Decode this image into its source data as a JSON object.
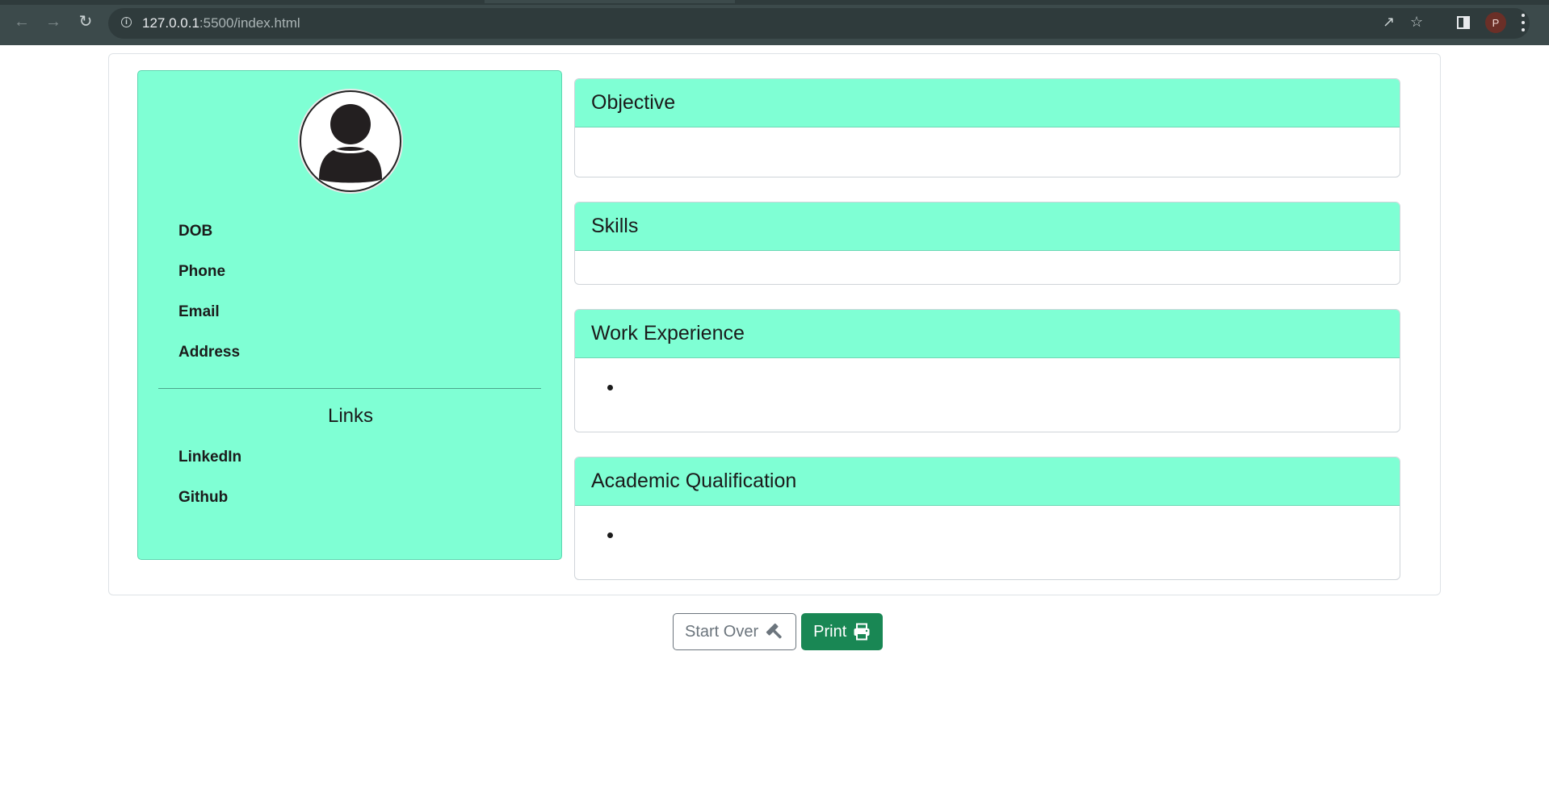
{
  "browser": {
    "url_host": "127.0.0.1",
    "url_rest": ":5500/index.html",
    "profile_initial": "P"
  },
  "profile": {
    "fields": [
      "DOB",
      "Phone",
      "Email",
      "Address"
    ],
    "links_heading": "Links",
    "links": [
      "LinkedIn",
      "Github"
    ]
  },
  "sections": {
    "objective": "Objective",
    "skills": "Skills",
    "work_experience": "Work Experience",
    "academic": "Academic Qualification"
  },
  "actions": {
    "start_over": "Start Over",
    "print": "Print"
  },
  "colors": {
    "panel": "#7fffd4",
    "success": "#198754",
    "chrome": "#3c4a4b"
  }
}
